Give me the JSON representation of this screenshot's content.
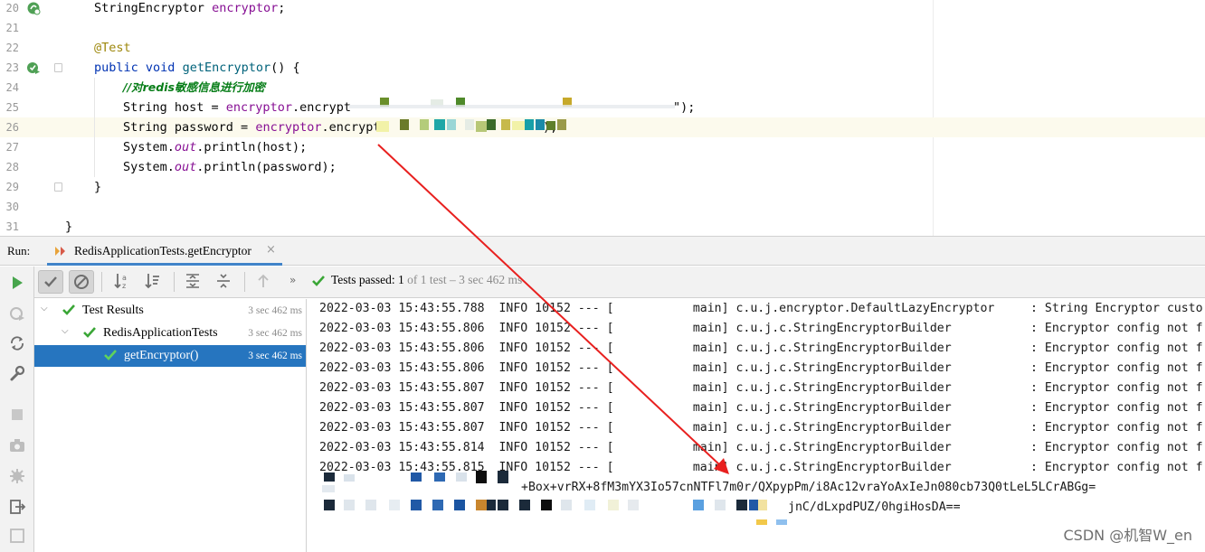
{
  "editor": {
    "lines": [
      {
        "no": "20"
      },
      {
        "no": "21"
      },
      {
        "no": "22"
      },
      {
        "no": "23"
      },
      {
        "no": "24"
      },
      {
        "no": "25"
      },
      {
        "no": "26"
      },
      {
        "no": "27"
      },
      {
        "no": "28"
      },
      {
        "no": "29"
      },
      {
        "no": "30"
      },
      {
        "no": "31"
      }
    ],
    "code": {
      "l20_type": "StringEncryptor",
      "l20_field": "encryptor",
      "l20_end": ";",
      "l22_annotation": "@Test",
      "l23_kw1": "public",
      "l23_kw2": "void",
      "l23_method": "getEncryptor",
      "l23_end": "() {",
      "l24_comment_prefix": "//对",
      "l24_comment_bold": "redis",
      "l24_comment_suffix": "敏感信息进行加密",
      "l25_decl": "String host = ",
      "l25_field": "encryptor",
      "l25_call": ".encrypt",
      "l25_tail": "\");",
      "l26_decl": "String password = ",
      "l26_field": "encryptor",
      "l26_call": ".encrypt",
      "l26_tail": ");",
      "l27_a": "System.",
      "l27_out": "out",
      "l27_b": ".println(host);",
      "l28_a": "System.",
      "l28_out": "out",
      "l28_b": ".println(password);",
      "l29": "}",
      "l31": "}"
    }
  },
  "run": {
    "label": "Run:",
    "tab_title": "RedisApplicationTests.getEncryptor",
    "tab_close": "×"
  },
  "test_toolbar": {
    "overflow": "»",
    "status_prefix": "Tests passed: ",
    "status_count": "1",
    "status_suffix": " of 1 test – 3 sec 462 ms"
  },
  "tree": [
    {
      "label": "Test Results",
      "time": "3 sec 462 ms"
    },
    {
      "label": "RedisApplicationTests",
      "time": "3 sec 462 ms"
    },
    {
      "label": "getEncryptor()",
      "time": "3 sec 462 ms"
    }
  ],
  "console": {
    "log_lines": [
      "2022-03-03 15:43:55.788  INFO 10152 --- [           main] c.u.j.encryptor.DefaultLazyEncryptor     : String Encryptor custo",
      "2022-03-03 15:43:55.806  INFO 10152 --- [           main] c.u.j.c.StringEncryptorBuilder           : Encryptor config not f",
      "2022-03-03 15:43:55.806  INFO 10152 --- [           main] c.u.j.c.StringEncryptorBuilder           : Encryptor config not f",
      "2022-03-03 15:43:55.806  INFO 10152 --- [           main] c.u.j.c.StringEncryptorBuilder           : Encryptor config not f",
      "2022-03-03 15:43:55.807  INFO 10152 --- [           main] c.u.j.c.StringEncryptorBuilder           : Encryptor config not f",
      "2022-03-03 15:43:55.807  INFO 10152 --- [           main] c.u.j.c.StringEncryptorBuilder           : Encryptor config not f",
      "2022-03-03 15:43:55.807  INFO 10152 --- [           main] c.u.j.c.StringEncryptorBuilder           : Encryptor config not f",
      "2022-03-03 15:43:55.814  INFO 10152 --- [           main] c.u.j.c.StringEncryptorBuilder           : Encryptor config not f",
      "2022-03-03 15:43:55.815  INFO 10152 --- [           main] c.u.j.c.StringEncryptorBuilder           : Encryptor config not f"
    ],
    "output_1": "+Box+vrRX+8fM3mYX3Io57cnNTFl7m0r/QXpypPm/i8Ac12vraYoAxIeJn080cb73Q0tLeL5LCrABGg=",
    "output_2": "jnC/dLxpdPUZ/0hgiHosDA=="
  },
  "watermark": "CSDN @机智W_en",
  "colors": {
    "accent": "#2675bf",
    "pass_green": "#3aa636",
    "arrow_red": "#e8201f"
  }
}
